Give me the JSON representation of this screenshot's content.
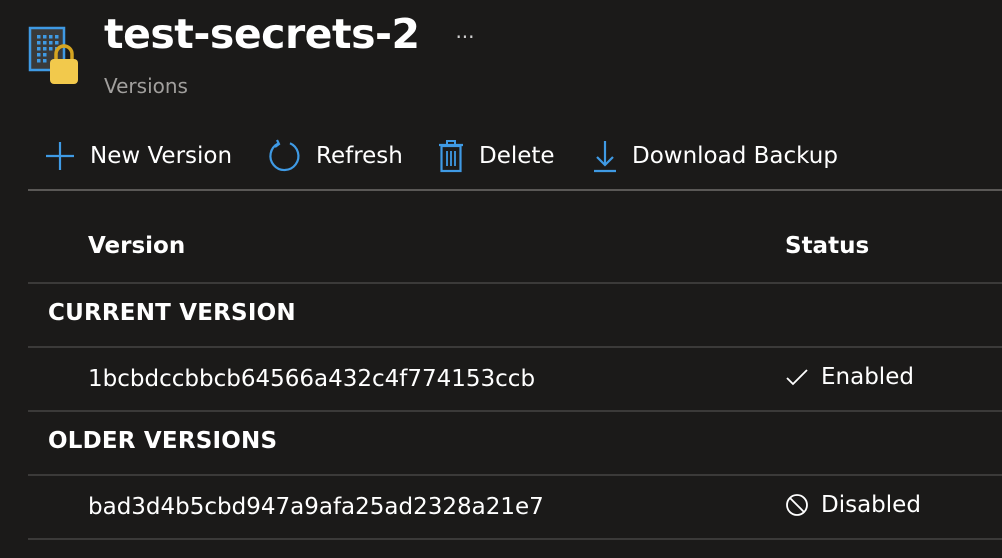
{
  "header": {
    "title": "test-secrets-2",
    "subtitle": "Versions",
    "more_label": "···",
    "icon": "key-vault-secret-icon"
  },
  "toolbar": {
    "new_version": {
      "label": "New Version",
      "icon": "plus-icon"
    },
    "refresh": {
      "label": "Refresh",
      "icon": "refresh-icon"
    },
    "delete": {
      "label": "Delete",
      "icon": "trash-icon"
    },
    "download": {
      "label": "Download Backup",
      "icon": "download-icon"
    }
  },
  "table": {
    "columns": {
      "version": "Version",
      "status": "Status"
    },
    "groups": [
      {
        "label": "CURRENT VERSION",
        "rows": [
          {
            "version": "1bcbdccbbcb64566a432c4f774153ccb",
            "status": "Enabled",
            "status_icon": "checkmark-icon"
          }
        ]
      },
      {
        "label": "OLDER VERSIONS",
        "rows": [
          {
            "version": "bad3d4b5cbd947a9afa25ad2328a21e7",
            "status": "Disabled",
            "status_icon": "disabled-circle-icon"
          }
        ]
      }
    ]
  },
  "colors": {
    "background": "#1b1a19",
    "accent": "#3f9ae4",
    "lock": "#f2c94c",
    "divider": "#3b3a39",
    "muted_text": "#a19f9d"
  }
}
